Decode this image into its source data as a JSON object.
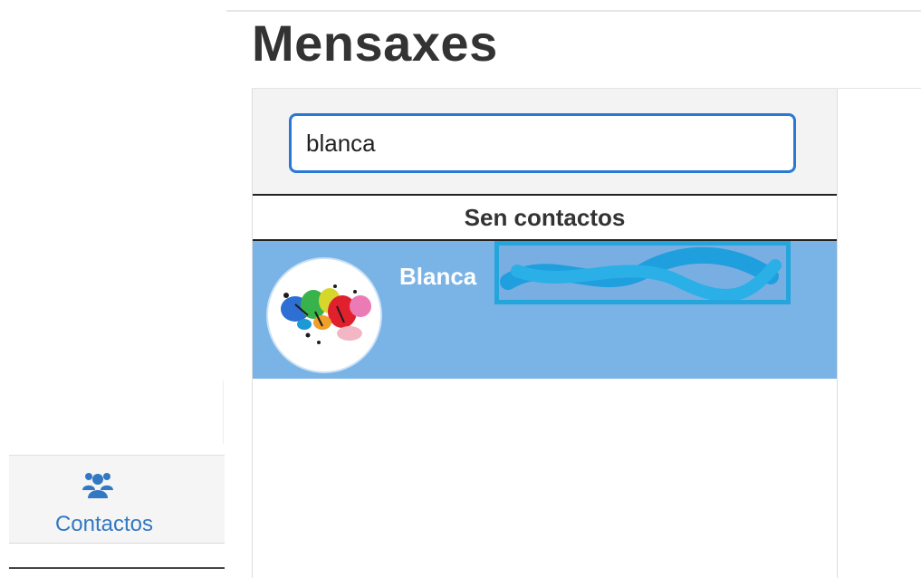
{
  "page": {
    "title": "Mensaxes"
  },
  "search": {
    "value": "blanca"
  },
  "results": {
    "section_title": "Sen contactos",
    "items": [
      {
        "name": "Blanca",
        "avatar": "paint-splash-avatar"
      }
    ]
  },
  "nav": {
    "contacts_label": "Contactos",
    "contacts_icon": "users-icon"
  },
  "colors": {
    "accent": "#3278c2",
    "selected_row": "#7ab3e6",
    "input_focus": "#2a78d6",
    "redaction": "#24a6dc"
  }
}
